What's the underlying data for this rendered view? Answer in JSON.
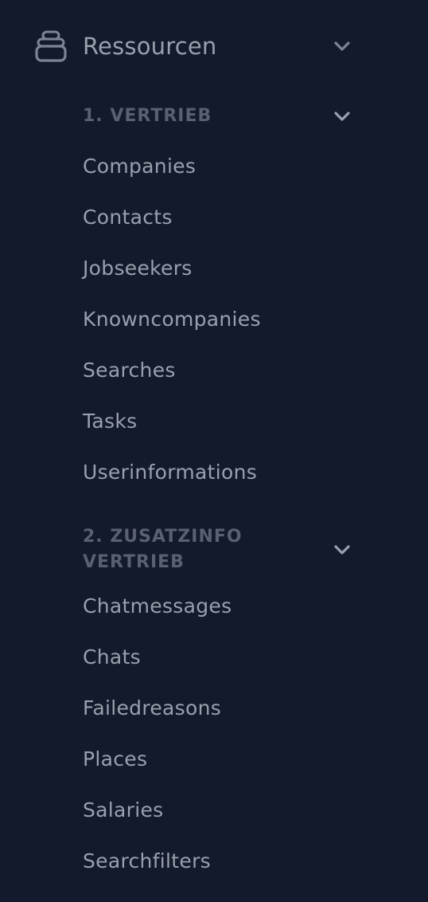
{
  "sidebar": {
    "main": {
      "label": "Ressourcen",
      "icon": "database-stack-icon"
    },
    "groups": [
      {
        "title": "1. VERTRIEB",
        "items": [
          "Companies",
          "Contacts",
          "Jobseekers",
          "Knowncompanies",
          "Searches",
          "Tasks",
          "Userinformations"
        ]
      },
      {
        "title": "2. ZUSATZINFO VERTRIEB",
        "items": [
          "Chatmessages",
          "Chats",
          "Failedreasons",
          "Places",
          "Salaries",
          "Searchfilters"
        ]
      }
    ]
  },
  "colors": {
    "background": "#131a2b",
    "link_text": "#99a0ad",
    "group_title": "#59606f",
    "icon": "#7c8496"
  }
}
